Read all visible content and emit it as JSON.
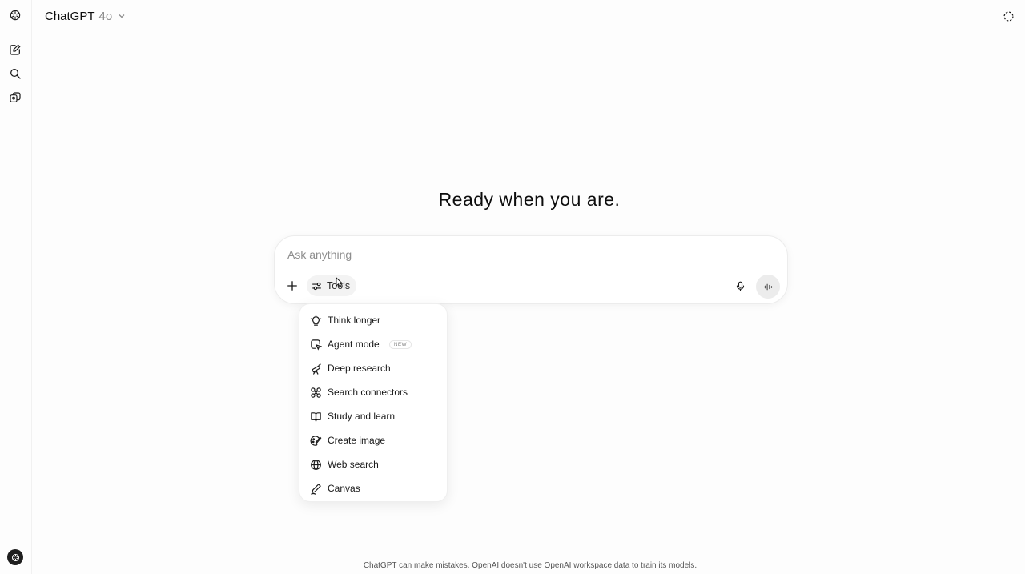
{
  "header": {
    "model_name": "ChatGPT",
    "model_version": "4o"
  },
  "sidebar": {
    "icons": [
      "openai-logo-icon",
      "new-chat-icon",
      "search-icon",
      "library-icon"
    ]
  },
  "main": {
    "headline": "Ready when you are."
  },
  "composer": {
    "placeholder": "Ask anything",
    "value": "",
    "tools_label": "Tools"
  },
  "tools_menu": {
    "items": [
      {
        "label": "Think longer",
        "icon": "lightbulb-icon"
      },
      {
        "label": "Agent mode",
        "icon": "agent-icon",
        "badge": "NEW"
      },
      {
        "label": "Deep research",
        "icon": "telescope-icon"
      },
      {
        "label": "Search connectors",
        "icon": "connectors-icon"
      },
      {
        "label": "Study and learn",
        "icon": "book-icon"
      },
      {
        "label": "Create image",
        "icon": "image-brush-icon"
      },
      {
        "label": "Web search",
        "icon": "globe-icon"
      },
      {
        "label": "Canvas",
        "icon": "pen-icon"
      }
    ]
  },
  "footer": {
    "disclaimer": "ChatGPT can make mistakes. OpenAI doesn't use OpenAI workspace data to train its models."
  }
}
